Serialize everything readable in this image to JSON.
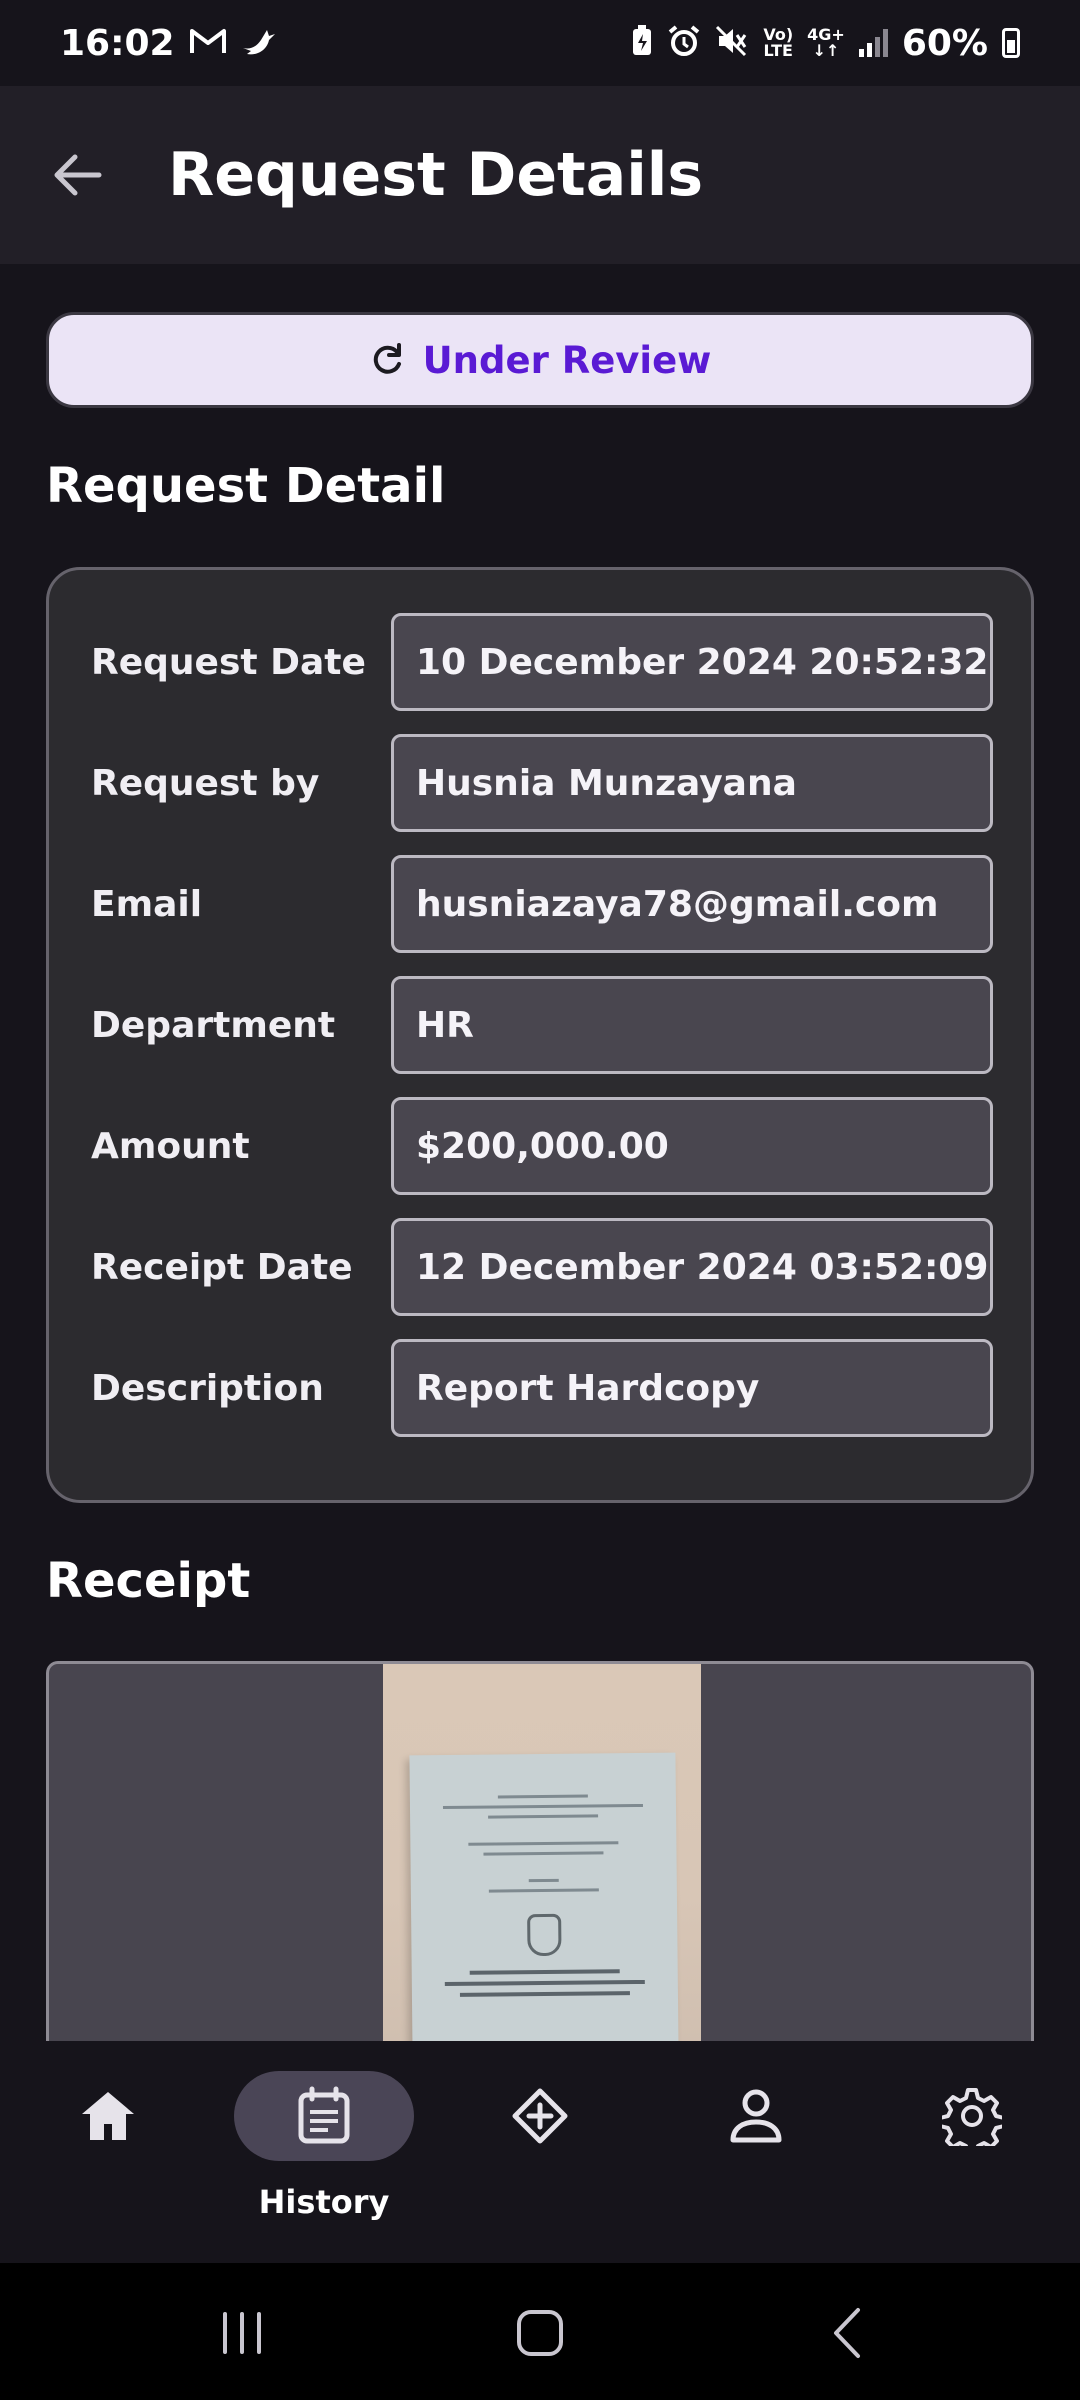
{
  "status_bar": {
    "time": "16:02",
    "network_top": "Vo)",
    "network_bottom": "LTE",
    "data_top": "4G+",
    "data_bottom": "↓↑",
    "battery_percent": "60%",
    "battery_level": 0.6
  },
  "app_bar": {
    "title": "Request Details",
    "back_icon": "arrow-left-icon"
  },
  "status_pill": {
    "label": "Under Review",
    "icon": "refresh-icon",
    "text_color": "#5a1ad4",
    "background": "#ebe4f6"
  },
  "sections": {
    "detail_title": "Request Detail",
    "receipt_title": "Receipt"
  },
  "details": [
    {
      "label": "Request Date",
      "value": "10 December 2024 20:52:32"
    },
    {
      "label": "Request by",
      "value": "Husnia Munzayana"
    },
    {
      "label": "Email",
      "value": "husniazaya78@gmail.com"
    },
    {
      "label": "Department",
      "value": "HR"
    },
    {
      "label": "Amount",
      "value": "$200,000.00"
    },
    {
      "label": "Receipt Date",
      "value": "12 December 2024 03:52:09"
    },
    {
      "label": "Description",
      "value": "Report Hardcopy"
    }
  ],
  "bottom_nav": {
    "items": [
      {
        "icon": "home-icon",
        "label": ""
      },
      {
        "icon": "calendar-history-icon",
        "label": "History",
        "active": true
      },
      {
        "icon": "diamond-plus-icon",
        "label": ""
      },
      {
        "icon": "person-icon",
        "label": ""
      },
      {
        "icon": "gear-icon",
        "label": ""
      }
    ]
  },
  "system_nav": {
    "recents_icon": "recents-icon",
    "home_icon": "home-square-icon",
    "back_icon": "chevron-left-icon"
  }
}
